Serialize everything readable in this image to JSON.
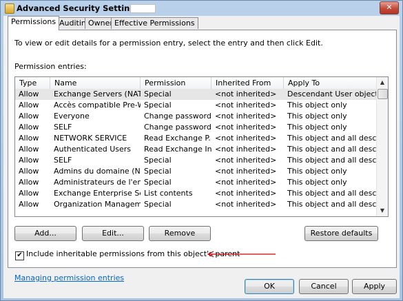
{
  "window": {
    "title": "Advanced Security Settings for",
    "close_glyph": "✕"
  },
  "tabs": [
    {
      "label": "Permissions",
      "active": true
    },
    {
      "label": "Auditing",
      "active": false
    },
    {
      "label": "Owner",
      "active": false
    },
    {
      "label": "Effective Permissions",
      "active": false
    }
  ],
  "permissions": {
    "intro": "To view or edit details for a permission entry, select the entry and then click Edit.",
    "entries_label": "Permission entries:",
    "columns": [
      "Type",
      "Name",
      "Permission",
      "Inherited From",
      "Apply To"
    ],
    "rows": [
      [
        "Allow",
        "Exchange Servers (NAT...",
        "Special",
        "<not inherited>",
        "Descendant User objects"
      ],
      [
        "Allow",
        "Accès compatible Pre-W...",
        "Special",
        "<not inherited>",
        "This object only"
      ],
      [
        "Allow",
        "Everyone",
        "Change password",
        "<not inherited>",
        "This object only"
      ],
      [
        "Allow",
        "SELF",
        "Change password",
        "<not inherited>",
        "This object only"
      ],
      [
        "Allow",
        "NETWORK SERVICE",
        "Read Exchange P...",
        "<not inherited>",
        "This object and all desce..."
      ],
      [
        "Allow",
        "Authenticated Users",
        "Read Exchange In...",
        "<not inherited>",
        "This object and all desce..."
      ],
      [
        "Allow",
        "SELF",
        "Special",
        "<not inherited>",
        "This object and all desce..."
      ],
      [
        "Allow",
        "Admins du domaine (NA...",
        "Special",
        "<not inherited>",
        "This object only"
      ],
      [
        "Allow",
        "Administrateurs de l'entre...",
        "Special",
        "<not inherited>",
        "This object only"
      ],
      [
        "Allow",
        "Exchange Enterprise Ser...",
        "List contents",
        "<not inherited>",
        "This object and all desce..."
      ],
      [
        "Allow",
        "Organization Manageme...",
        "Special",
        "<not inherited>",
        "This object and all desce..."
      ]
    ],
    "selected_row": 0,
    "scroll_up": "▲",
    "scroll_down": "▼",
    "buttons": {
      "add": "Add...",
      "edit": "Edit...",
      "remove": "Remove",
      "restore": "Restore defaults"
    },
    "inherit_checkbox": {
      "checked": true,
      "check_glyph": "✔",
      "label": "Include inheritable permissions from this object's parent"
    },
    "annotation_color": "#cc0000",
    "link": "Managing permission entries"
  },
  "footer": {
    "ok": "OK",
    "cancel": "Cancel",
    "apply": "Apply"
  }
}
